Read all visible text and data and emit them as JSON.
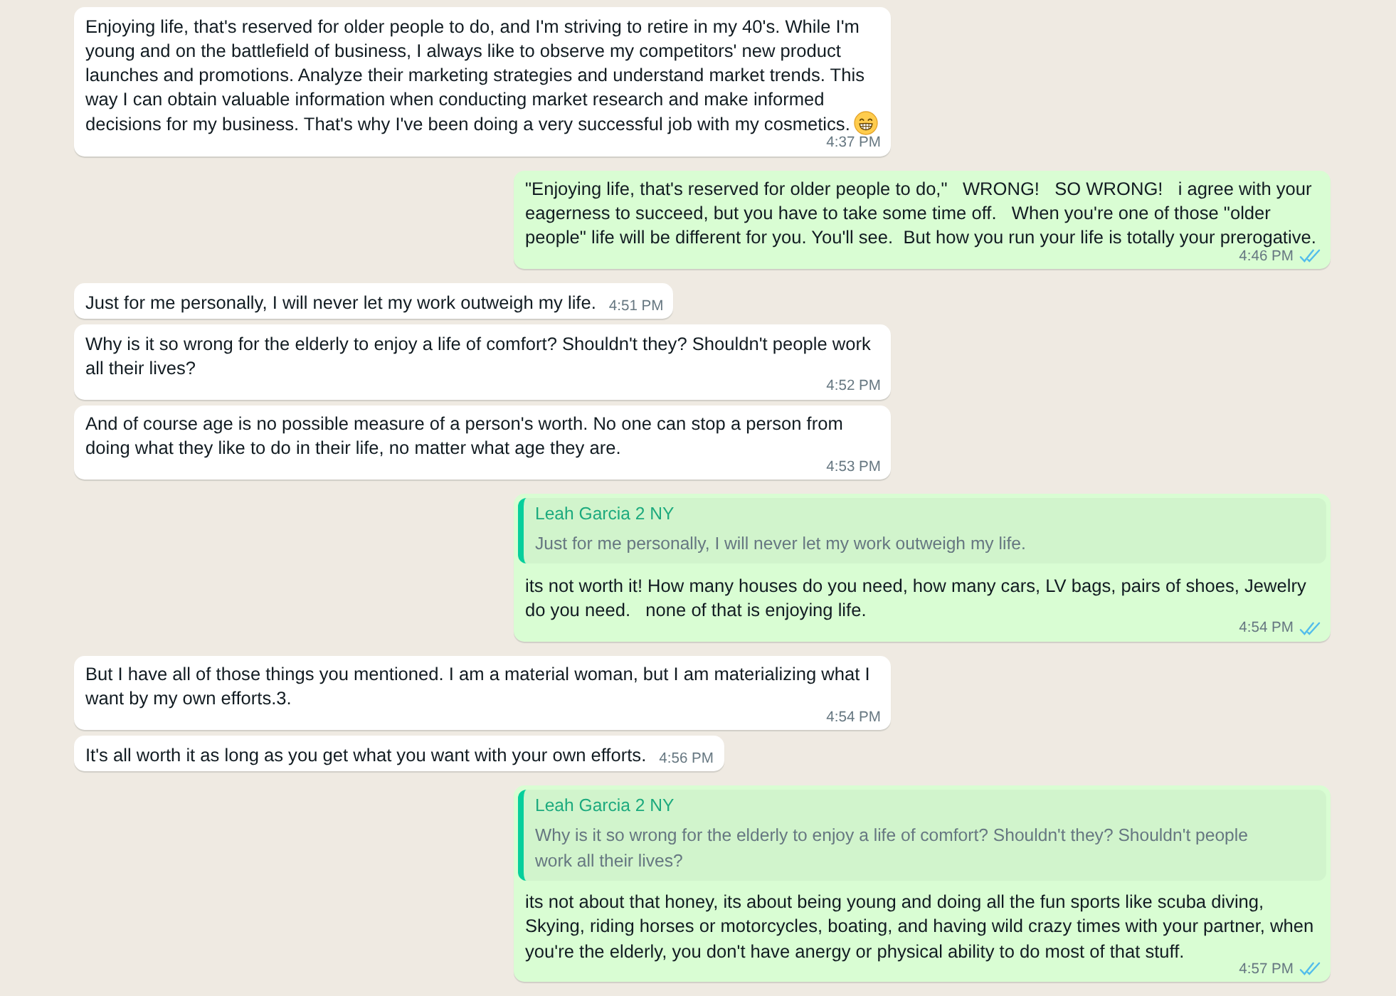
{
  "messages": [
    {
      "kind": "incoming",
      "text": "Enjoying life, that's reserved for older people to do, and I'm striving to retire in my 40's. While I'm young and on the battlefield of business, I always like to observe my competitors' new product launches and promotions. Analyze their marketing strategies and understand market trends. This way I can obtain valuable information when conducting market research and make informed decisions for my business. That's why I've been doing a very successful job with my cosmetics.",
      "emoji": true,
      "time": "4:37 PM"
    },
    {
      "kind": "outgoing",
      "text": "\"Enjoying life, that's reserved for older people to do,\"   WRONG!   SO WRONG!   i agree with your eagerness to succeed, but you have to take some time off.   When you're one of those \"older people\" life will be different for you. You'll see.  But how you run your life is totally your prerogative.",
      "emoji": false,
      "time": "4:46 PM",
      "read": true
    },
    {
      "kind": "incoming",
      "text": "Just for me personally, I will never let my work outweigh my life.",
      "emoji": false,
      "time": "4:51 PM"
    },
    {
      "kind": "incoming",
      "text": "Why is it so wrong for the elderly to enjoy a life of comfort? Shouldn't they? Shouldn't people work all their lives?",
      "emoji": false,
      "time": "4:52 PM"
    },
    {
      "kind": "incoming",
      "text": "And of course age is no possible measure of a person's worth. No one can stop a person from doing what they like to do in their life, no matter what age they are.",
      "emoji": false,
      "time": "4:53 PM"
    },
    {
      "kind": "outgoing",
      "quote": {
        "author": "Leah Garcia 2 NY",
        "text": "Just for me personally, I will never let my work outweigh my life."
      },
      "text": "its not worth it! How many houses do you need, how many cars, LV bags, pairs of shoes, Jewelry do you need.   none of that is enjoying life.",
      "emoji": false,
      "time": "4:54 PM",
      "read": true
    },
    {
      "kind": "incoming",
      "text": "But I have all of those things you mentioned. I am a material woman, but I am materializing what I want by my own efforts.3.",
      "emoji": false,
      "time": "4:54 PM"
    },
    {
      "kind": "incoming",
      "text": "It's all worth it as long as you get what you want with your own efforts.",
      "emoji": false,
      "time": "4:56 PM"
    },
    {
      "kind": "outgoing",
      "quote": {
        "author": "Leah Garcia 2 NY",
        "text": "Why is it so wrong for the elderly to enjoy a life of comfort? Shouldn't they? Shouldn't people work all their lives?"
      },
      "text": "its not about that honey, its about being young and doing all the fun sports like scuba diving, Skying, riding horses or motorcycles, boating, and having wild crazy times with your partner, when you're the elderly, you don't have anergy or physical ability to do most of that stuff.",
      "emoji": false,
      "time": "4:57 PM",
      "read": true
    }
  ]
}
